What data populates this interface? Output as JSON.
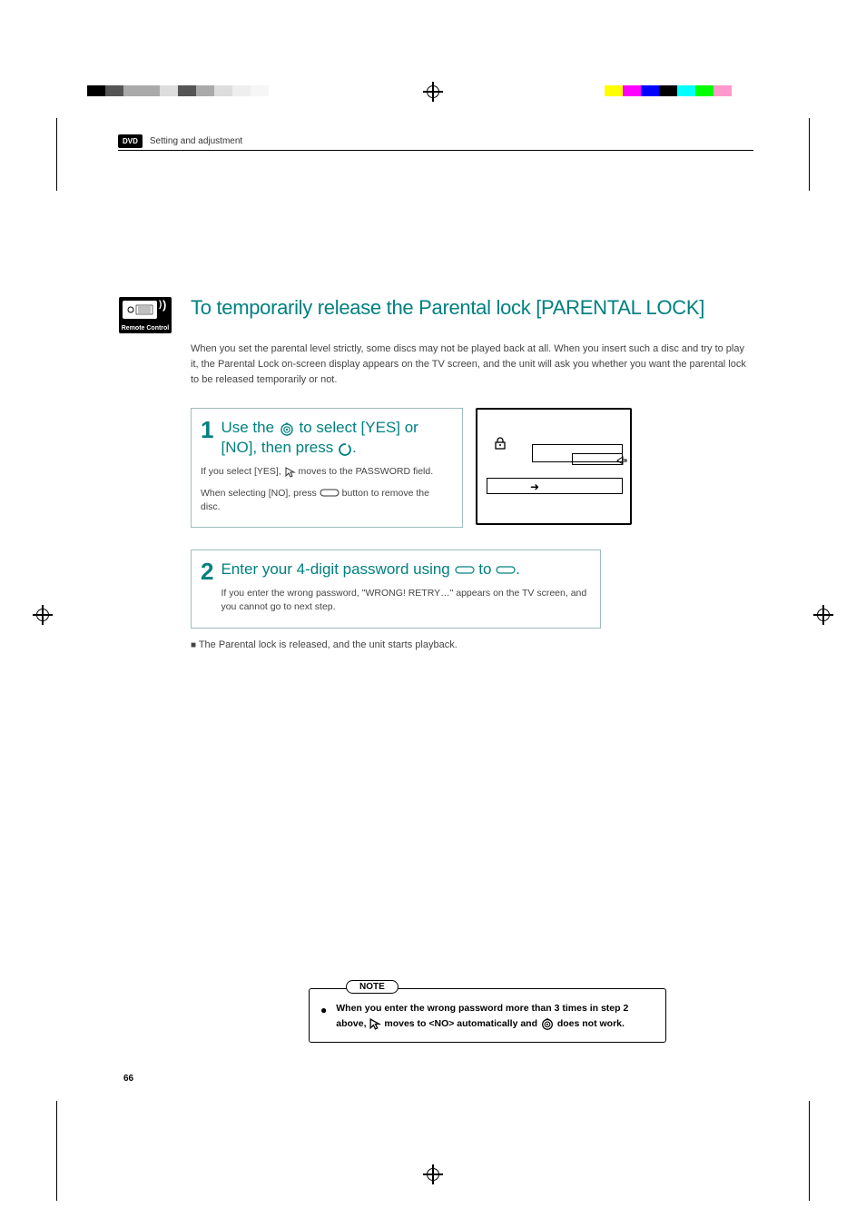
{
  "header": {
    "badge": "DVD",
    "section": "Setting and adjustment"
  },
  "remote_label": "Remote Control",
  "title": "To temporarily release the Parental lock [PARENTAL LOCK]",
  "intro": "When you set the parental level strictly, some discs may not be played back at all. When you insert such a disc and try to play it, the Parental Lock on-screen display appears on the TV screen, and the unit will ask you whether you want the parental lock to be released temporarily or not.",
  "steps": {
    "s1": {
      "num": "1",
      "head_a": "Use the ",
      "head_b": " to select [YES] or [NO], then press ",
      "head_c": ".",
      "sub1_a": "If you select [YES], ",
      "sub1_b": " moves to the PASSWORD field.",
      "sub2_a": "When selecting [NO], press ",
      "sub2_b": " button to remove the disc."
    },
    "s2": {
      "num": "2",
      "head_a": "Enter your 4-digit password using ",
      "head_b": " to ",
      "head_c": ".",
      "sub": "If you enter the wrong password, \"WRONG! RETRY…\" appears on the TV screen, and you cannot go to next step."
    }
  },
  "released": "The Parental lock is released, and the unit starts playback.",
  "note": {
    "label": "NOTE",
    "body_a": "When you enter the wrong password more than 3 times in step 2 above, ",
    "body_b": " moves to <NO> automatically and ",
    "body_c": " does not work."
  },
  "page_number": "66"
}
